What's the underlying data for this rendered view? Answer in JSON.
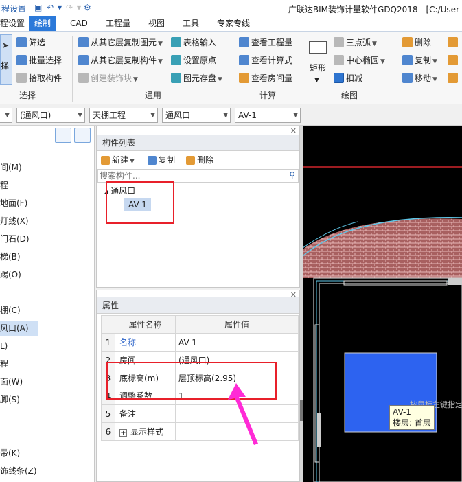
{
  "window": {
    "title": "广联达BIM装饰计量软件GDQ2018 - [C:/User"
  },
  "quick_access": {
    "left_fragment": "程设置"
  },
  "ribbon_tabs": [
    {
      "label": "绘制",
      "active": true
    },
    {
      "label": "CAD"
    },
    {
      "label": "工程量"
    },
    {
      "label": "视图"
    },
    {
      "label": "工具"
    },
    {
      "label": "专家专线"
    }
  ],
  "ribbon": {
    "select_group": {
      "label": "选择",
      "select_button_fragment": "择",
      "filter": "筛选",
      "batch_select": "批量选择",
      "pick_component": "拾取构件"
    },
    "common_group": {
      "label": "通用",
      "copy_from_layer": "从其它层复制图元",
      "copy_component": "从其它层复制构件",
      "create_decoration": "创建装饰块",
      "table_input": "表格输入",
      "set_origin": "设置原点",
      "save_element": "图元存盘"
    },
    "calc_group": {
      "label": "计算",
      "view_quantity": "查看工程量",
      "view_formula": "查看计算式",
      "view_room": "查看房间量"
    },
    "draw_group": {
      "label": "绘图",
      "rect": "矩形",
      "three_point_arc": "三点弧",
      "center_ellipse": "中心椭圆",
      "deduct": "扣减"
    },
    "edit_group": {
      "delete": "删除",
      "copy": "复制",
      "move": "移动"
    }
  },
  "combos": {
    "combo1_value": "",
    "combo2_value": "(通风口)",
    "combo3_value": "天棚工程",
    "combo4_value": "通风口",
    "combo5_value": "AV-1"
  },
  "left_tree": [
    {
      "label": "间(M)"
    },
    {
      "label": "程"
    },
    {
      "label": "地面(F)"
    },
    {
      "label": "灯线(X)"
    },
    {
      "label": "门石(D)"
    },
    {
      "label": "梯(B)"
    },
    {
      "label": "踢(O)"
    },
    {
      "label": ""
    },
    {
      "label": "棚(C)"
    },
    {
      "label": "风口(A)",
      "selected": true
    },
    {
      "label": "L)"
    },
    {
      "label": "程"
    },
    {
      "label": "面(W)"
    },
    {
      "label": "脚(S)"
    },
    {
      "label": ""
    },
    {
      "label": "带(K)"
    },
    {
      "label": "饰线条(Z)"
    }
  ],
  "component_list": {
    "title": "构件列表",
    "new_label": "新建",
    "copy_label": "复制",
    "delete_label": "删除",
    "search_placeholder": "搜索构件...",
    "root_node": "通风口",
    "child_node": "AV-1"
  },
  "properties": {
    "title": "属性",
    "col_name": "属性名称",
    "col_value": "属性值",
    "rows": [
      {
        "num": "1",
        "name": "名称",
        "value": "AV-1"
      },
      {
        "num": "2",
        "name": "房间",
        "value": "(通风口)"
      },
      {
        "num": "3",
        "name": "底标高(m)",
        "value": "层顶标高(2.95)"
      },
      {
        "num": "4",
        "name": "调整系数",
        "value": "1"
      },
      {
        "num": "5",
        "name": "备注",
        "value": ""
      },
      {
        "num": "6",
        "name": "显示样式",
        "value": ""
      }
    ]
  },
  "canvas": {
    "tooltip_name": "AV-1",
    "tooltip_floor": "楼层: 首层",
    "hint_text": "按鼠标左键指定"
  }
}
